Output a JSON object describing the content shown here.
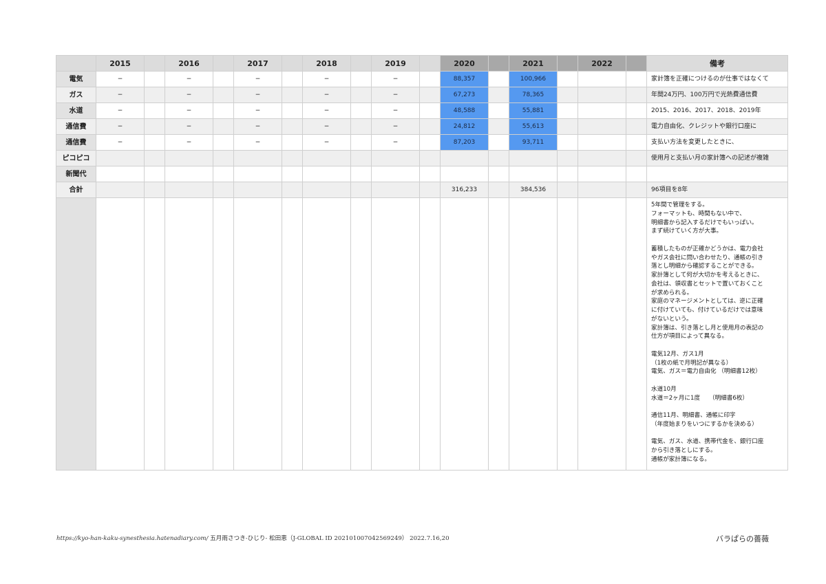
{
  "header": {
    "years": [
      "2015",
      "2016",
      "2017",
      "2018",
      "2019",
      "2020",
      "2021",
      "2022"
    ],
    "notes_label": "備考"
  },
  "rows": [
    {
      "label": "電気",
      "values": [
        "−",
        "−",
        "−",
        "−",
        "−",
        "88,357",
        "100,966",
        ""
      ],
      "note": "家計簿を正確につけるのが仕事ではなくて"
    },
    {
      "label": "ガス",
      "values": [
        "−",
        "−",
        "−",
        "−",
        "−",
        "67,273",
        "78,365",
        ""
      ],
      "note": "年間24万円、100万円で光熱費通信費"
    },
    {
      "label": "水道",
      "values": [
        "−",
        "−",
        "−",
        "−",
        "−",
        "48,588",
        "55,881",
        ""
      ],
      "note": "2015、2016、2017、2018、2019年"
    },
    {
      "label": "通信費",
      "values": [
        "−",
        "−",
        "−",
        "−",
        "−",
        "24,812",
        "55,613",
        ""
      ],
      "note": "電力自由化、クレジットや銀行口座に"
    },
    {
      "label": "通信費",
      "values": [
        "−",
        "−",
        "−",
        "−",
        "−",
        "87,203",
        "93,711",
        ""
      ],
      "note": "支払い方法を変更したときに、"
    },
    {
      "label": "ピコピコ",
      "values": [
        "",
        "",
        "",
        "",
        "",
        "",
        "",
        ""
      ],
      "note": "使用月と支払い月の家計簿への記述が複雑"
    },
    {
      "label": "新聞代",
      "values": [
        "",
        "",
        "",
        "",
        "",
        "",
        "",
        ""
      ],
      "note": ""
    },
    {
      "label": "合計",
      "values": [
        "",
        "",
        "",
        "",
        "",
        "316,233",
        "384,536",
        ""
      ],
      "note": "96項目を8年"
    }
  ],
  "memo": "5年間で管理をする。\nフォーマットも、時間もない中で、\n明細書から記入するだけでもいっぱい。\nまず続けていく方が大事。\n\n蓄積したものが正確かどうかは、電力会社\nやガス会社に問い合わせたり、通帳の引き\n落とし明細から確認することができる。\n家計簿として何が大切かを考えるときに、\n会社は、領収書とセットで置いておくこと\nが求められる。\n家庭のマネージメントとしては、逆に正確\nに付けていても、付けているだけでは意味\nがないという。\n家計簿は、引き落とし月と使用月の表記の\n仕方が項目によって異なる。\n\n電気12月、ガス1月\n（1枚の紙で月明記が異なる）\n電気、ガス＝電力自由化 （明細書12枚）\n\n水道10月\n水道＝2ヶ月に1度　　（明細書6枚）\n\n通信11月、明細書、通帳に印字\n（年度始まりをいつにするかを決める）\n\n電気、ガス、水道、携帯代金を、銀行口座\nから引き落としにする。\n通帳が家計簿になる。",
  "footer": {
    "url": "https://kyo-han-kaku-synesthesia.hatenadiary.com/",
    "credit": " 五月雨さつき-ひじり- 松田恵（J-GLOBAL ID 202101007042569249） 2022.7.16,20",
    "title": "バラぱらの薔薇"
  },
  "colors": {
    "highlight": "#5599f0",
    "header_gray": "#dcdcdc",
    "header_dark": "#a8a8a8",
    "stripe": "#efefef"
  }
}
